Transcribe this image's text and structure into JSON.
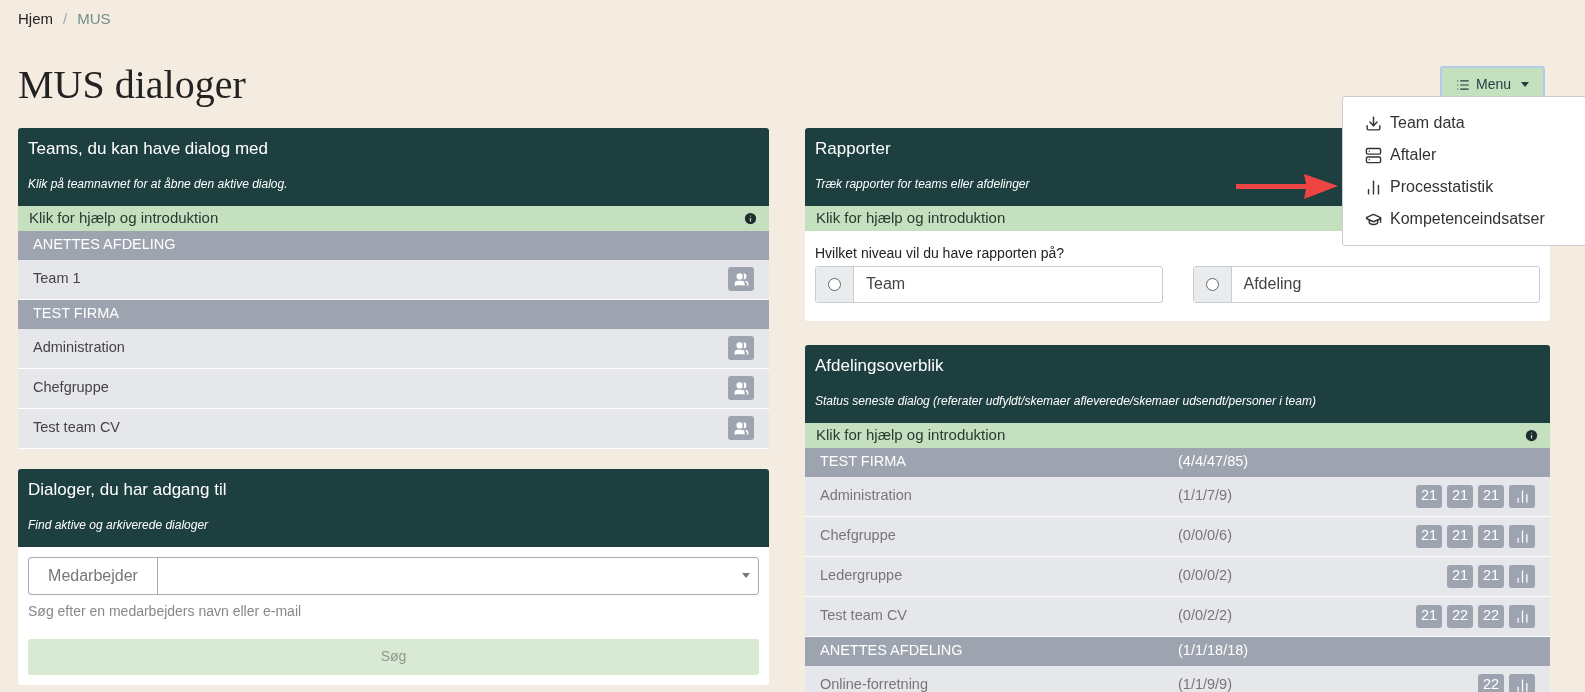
{
  "breadcrumb": {
    "separator": "/",
    "items": [
      {
        "label": "Hjem",
        "active": false
      },
      {
        "label": "MUS",
        "active": true
      }
    ]
  },
  "title": "MUS dialoger",
  "menu": {
    "label": "Menu",
    "expanded": true,
    "items": [
      {
        "label": "Team data"
      },
      {
        "label": "Aftaler"
      },
      {
        "label": "Processtatistik"
      },
      {
        "label": "Kompetenceindsatser"
      }
    ]
  },
  "teams_card": {
    "title": "Teams, du kan have dialog med",
    "subtitle": "Klik på teamnavnet for at åbne den aktive dialog.",
    "help": "Klik for hjælp og introduktion",
    "info_icon": true,
    "groups": [
      {
        "name": "ANETTES AFDELING",
        "teams": [
          {
            "name": "Team 1"
          }
        ]
      },
      {
        "name": "TEST FIRMA",
        "teams": [
          {
            "name": "Administration"
          },
          {
            "name": "Chefgruppe"
          },
          {
            "name": "Test team CV"
          }
        ]
      }
    ]
  },
  "dialogs_card": {
    "title": "Dialoger, du har adgang til",
    "subtitle": "Find aktive og arkiverede dialoger",
    "field_label": "Medarbejder",
    "hint": "Søg efter en medarbejders navn eller e-mail",
    "button": {
      "label": "Søg",
      "disabled": true
    }
  },
  "reports_card": {
    "title": "Rapporter",
    "subtitle": "Træk rapporter for teams eller afdelinger",
    "help": "Klik for hjælp og introduktion",
    "question": "Hvilket niveau vil du have rapporten på?",
    "options": [
      {
        "label": "Team",
        "selected": false
      },
      {
        "label": "Afdeling",
        "selected": false
      }
    ]
  },
  "overview_card": {
    "title": "Afdelingsoverblik",
    "subtitle": "Status seneste dialog (referater udfyldt/skemaer afleverede/skemaer udsendt/personer i team)",
    "help": "Klik for hjælp og introduktion",
    "info_icon": true,
    "groups": [
      {
        "name": "TEST FIRMA",
        "status": "(4/4/47/85)",
        "teams": [
          {
            "name": "Administration",
            "status": "(1/1/7/9)",
            "badges": [
              "21",
              "21",
              "21"
            ]
          },
          {
            "name": "Chefgruppe",
            "status": "(0/0/0/6)",
            "badges": [
              "21",
              "21",
              "21"
            ]
          },
          {
            "name": "Ledergruppe",
            "status": "(0/0/0/2)",
            "badges": [
              "21",
              "21"
            ]
          },
          {
            "name": "Test team CV",
            "status": "(0/0/2/2)",
            "badges": [
              "21",
              "22",
              "22"
            ]
          }
        ]
      },
      {
        "name": "ANETTES AFDELING",
        "status": "(1/1/18/18)",
        "teams": [
          {
            "name": "Online-forretning",
            "status": "(1/1/9/9)",
            "badges": [
              "22"
            ]
          }
        ]
      }
    ]
  }
}
